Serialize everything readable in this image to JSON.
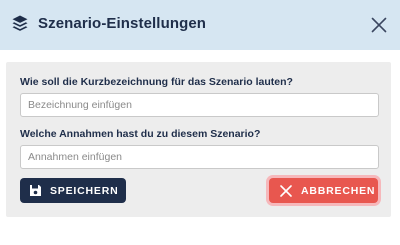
{
  "header": {
    "title": "Szenario-Einstellungen",
    "icon": "layers-icon",
    "close_icon": "close-icon"
  },
  "form": {
    "name_label": "Wie soll die Kurzbezeichnung für das Szenario lauten?",
    "name_placeholder": "Bezeichnung einfügen",
    "name_value": "",
    "assumptions_label": "Welche Annahmen hast du zu diesem Szenario?",
    "assumptions_placeholder": "Annahmen einfügen",
    "assumptions_value": ""
  },
  "buttons": {
    "save_label": "SPEICHERN",
    "save_icon": "save-icon",
    "cancel_label": "ABBRECHEN",
    "cancel_icon": "close-icon"
  },
  "colors": {
    "header_bg": "#d6e6f2",
    "text_dark": "#1f2e4a",
    "panel_bg": "#ededed",
    "save_bg": "#1f2e4a",
    "cancel_bg": "#e8574f",
    "cancel_focus_ring": "#f6b8bb"
  }
}
